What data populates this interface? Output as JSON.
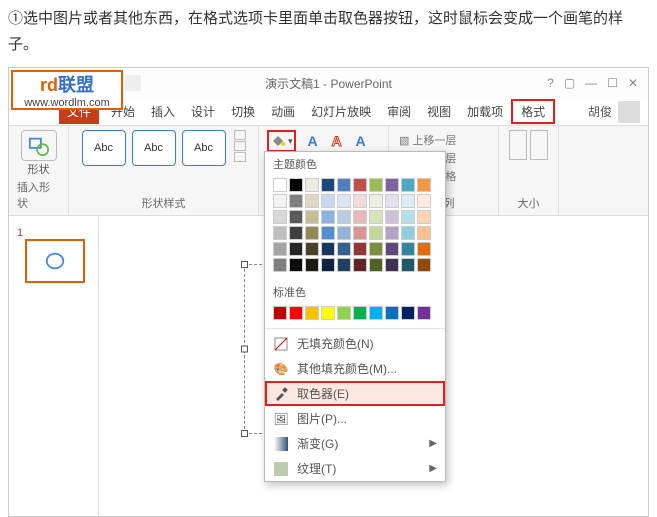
{
  "instruction": "①选中图片或者其他东西，在格式选项卡里面单击取色器按钮，这时鼠标会变成一个画笔的样子。",
  "titlebar": {
    "title": "演示文稿1 - PowerPoint"
  },
  "logo": {
    "big1": "rd",
    "big2": "联盟",
    "url": "www.wordlm.com"
  },
  "tabs": {
    "file": "文件",
    "home": "开始",
    "insert": "插入",
    "design": "设计",
    "trans": "切换",
    "anim": "动画",
    "slideshow": "幻灯片放映",
    "review": "审阅",
    "view": "视图",
    "addins": "加载项",
    "format": "格式"
  },
  "user": "胡俊",
  "ribbon": {
    "insertShape": "插入形状",
    "shape": "形状",
    "abc": "Abc",
    "shapeStyles": "形状样式",
    "arrange": "排列",
    "size": "大小",
    "bringFwd": "上移一层",
    "sendBack": "下移一层",
    "selPane": "选择窗格"
  },
  "slideIndex": "1",
  "dropdown": {
    "themeColors": "主题颜色",
    "themeGrid": [
      [
        "#ffffff",
        "#000000",
        "#eeece1",
        "#1f497d",
        "#4f81bd",
        "#c0504d",
        "#9bbb59",
        "#8064a2",
        "#4bacc6",
        "#f79646"
      ],
      [
        "#f2f2f2",
        "#7f7f7f",
        "#ddd9c3",
        "#c6d9f0",
        "#dbe5f1",
        "#f2dcdb",
        "#ebf1dd",
        "#e5e0ec",
        "#dbeef3",
        "#fdeada"
      ],
      [
        "#d8d8d8",
        "#595959",
        "#c4bd97",
        "#8db3e2",
        "#b8cce4",
        "#e5b9b7",
        "#d7e3bc",
        "#ccc1d9",
        "#b7dde8",
        "#fbd5b5"
      ],
      [
        "#bfbfbf",
        "#3f3f3f",
        "#938953",
        "#548dd4",
        "#95b3d7",
        "#d99694",
        "#c3d69b",
        "#b2a2c7",
        "#92cddc",
        "#fac08f"
      ],
      [
        "#a5a5a5",
        "#262626",
        "#494429",
        "#17365d",
        "#366092",
        "#953734",
        "#76923c",
        "#5f497a",
        "#31859b",
        "#e36c09"
      ],
      [
        "#7f7f7f",
        "#0c0c0c",
        "#1d1b10",
        "#0f243e",
        "#244061",
        "#632423",
        "#4f6128",
        "#3f3151",
        "#205867",
        "#974806"
      ]
    ],
    "standardColors": "标准色",
    "standardRow": [
      "#c00000",
      "#ff0000",
      "#ffc000",
      "#ffff00",
      "#92d050",
      "#00b050",
      "#00b0f0",
      "#0070c0",
      "#002060",
      "#7030a0"
    ],
    "noFill": "无填充颜色(N)",
    "moreColors": "其他填充颜色(M)...",
    "eyedropper": "取色器(E)",
    "picture": "图片(P)...",
    "gradient": "渐变(G)",
    "texture": "纹理(T)"
  }
}
